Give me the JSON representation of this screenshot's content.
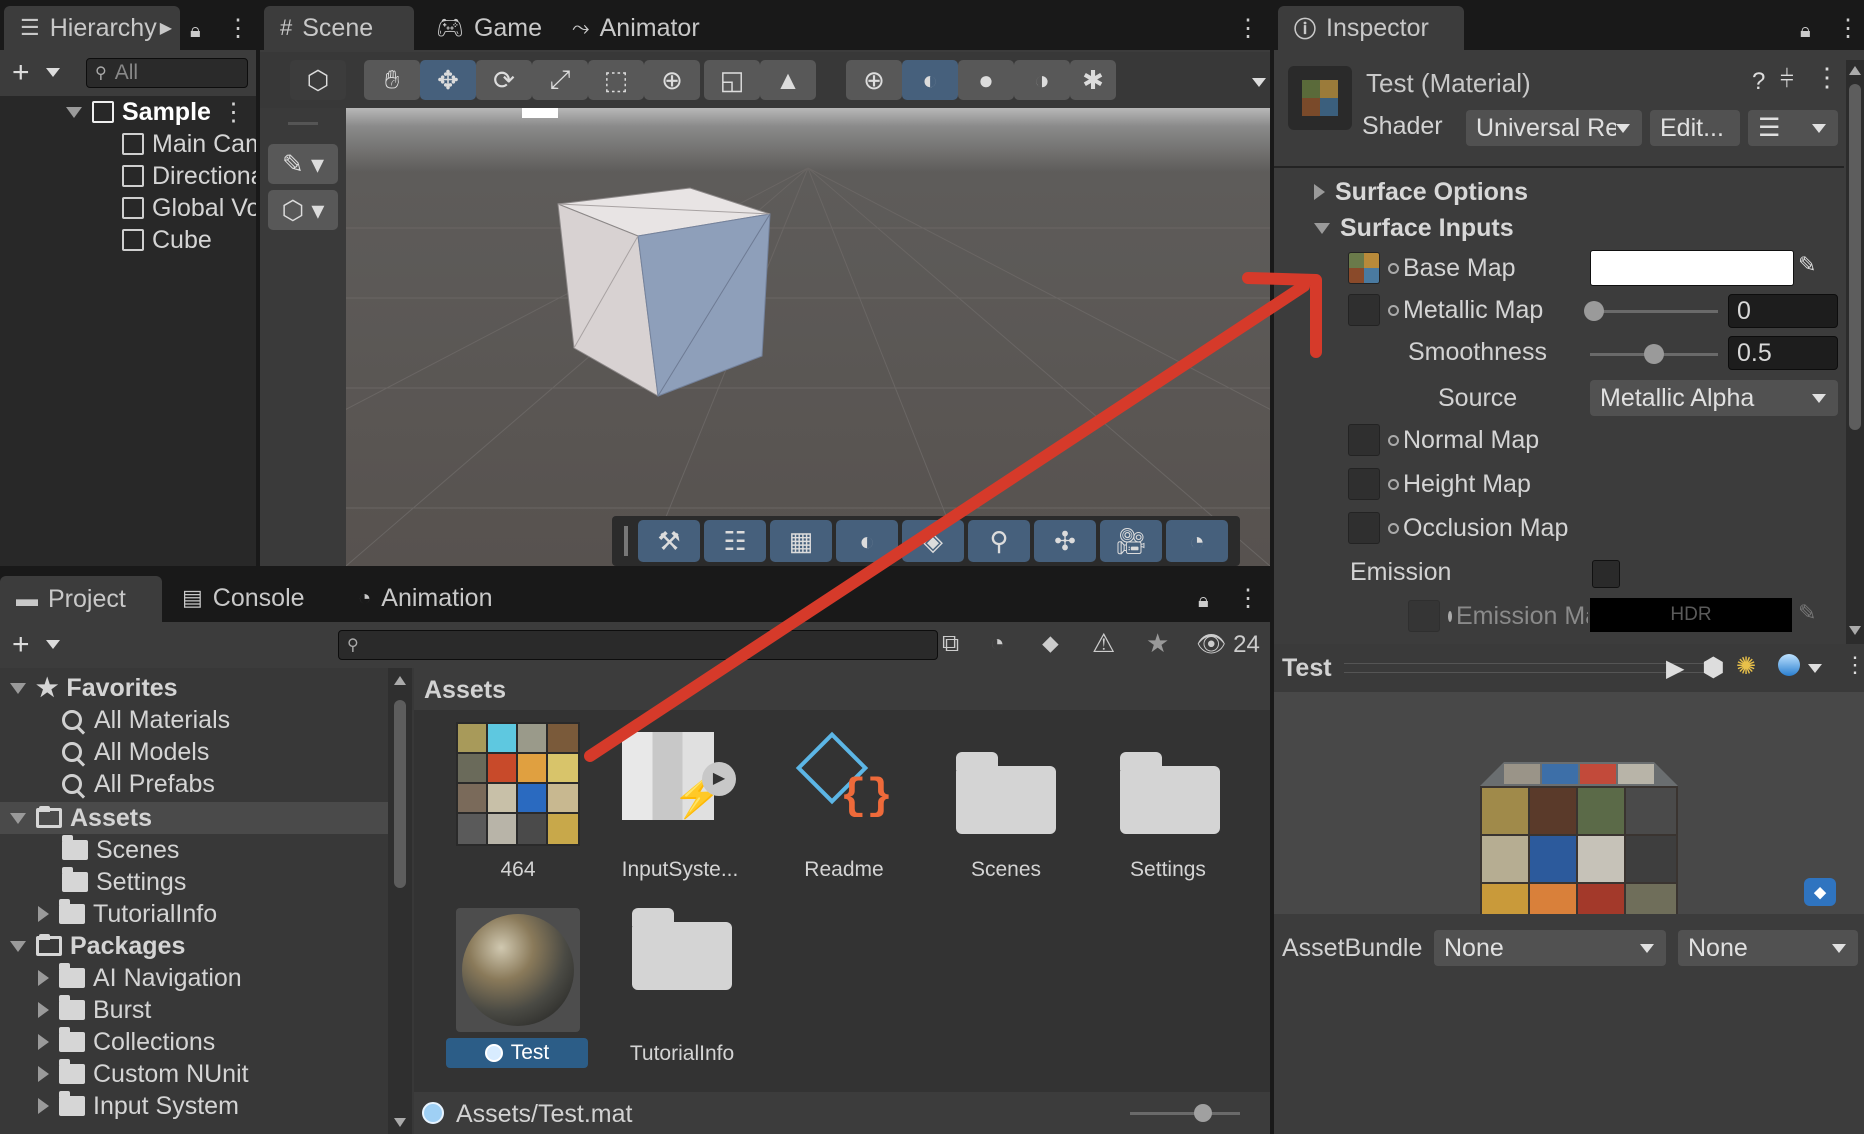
{
  "hierarchy": {
    "tab_label": "Hierarchy",
    "search_placeholder": "All",
    "scene_name": "Sample",
    "items": [
      "Main Camera",
      "Directional Light",
      "Global Volume",
      "Cube"
    ]
  },
  "scene_view": {
    "tabs": [
      "Scene",
      "Game",
      "Animator"
    ]
  },
  "inspector": {
    "tab_label": "Inspector",
    "title": "Test (Material)",
    "shader_label": "Shader",
    "shader_value": "Universal Render Pipeline/Lit",
    "edit_label": "Edit...",
    "surface_options": "Surface Options",
    "surface_inputs": "Surface Inputs",
    "base_map": "Base Map",
    "metallic_map": "Metallic Map",
    "metallic_value": "0",
    "metallic_level": 0.0,
    "smoothness": "Smoothness",
    "smoothness_value": "0.5",
    "smoothness_level": 0.5,
    "source": "Source",
    "source_value": "Metallic Alpha",
    "normal_map": "Normal Map",
    "height_map": "Height Map",
    "occlusion_map": "Occlusion Map",
    "emission": "Emission",
    "emission_map": "Emission Map",
    "hdr": "HDR",
    "base_color": "#ffffff"
  },
  "preview": {
    "title": "Test",
    "assetbundle_label": "AssetBundle",
    "bundle_value": "None",
    "variant_value": "None"
  },
  "project": {
    "tabs": [
      "Project",
      "Console",
      "Animation"
    ],
    "hidden_count": "24",
    "tree": {
      "favorites": "Favorites",
      "fav_items": [
        "All Materials",
        "All Models",
        "All Prefabs"
      ],
      "assets": "Assets",
      "asset_items": [
        "Scenes",
        "Settings",
        "TutorialInfo"
      ],
      "packages": "Packages",
      "package_items": [
        "AI Navigation",
        "Burst",
        "Collections",
        "Custom NUnit",
        "Input System"
      ]
    },
    "breadcrumb": "Assets",
    "grid": [
      "464",
      "InputSyste...",
      "Readme",
      "Scenes",
      "Settings",
      "Test",
      "TutorialInfo"
    ],
    "status_path": "Assets/Test.mat"
  },
  "colors": {
    "accent": "#46607c",
    "selection": "#2c5d87",
    "arrow": "#d63a2a"
  }
}
